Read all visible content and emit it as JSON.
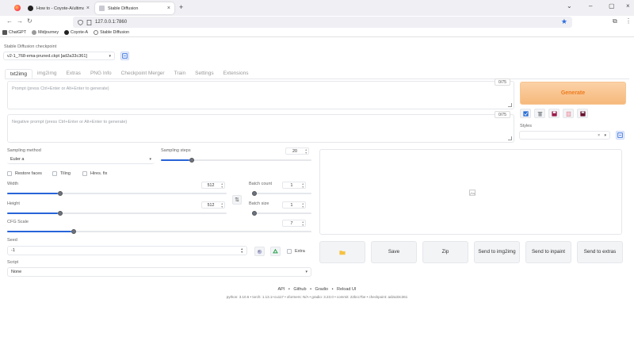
{
  "browser": {
    "tabs": [
      {
        "label": "How to - Coyote-A/ultimate-up",
        "active": false
      },
      {
        "label": "Stable Diffusion",
        "active": true
      }
    ],
    "url": "127.0.0.1:7860",
    "bookmarks": [
      "ChatGPT",
      "Midjourney",
      "Coyote-A",
      "Stable Diffusion"
    ]
  },
  "app": {
    "checkpoint": {
      "label": "Stable Diffusion checkpoint",
      "value": "v2-1_768-ema-pruned.ckpt [ad2a33c361]"
    },
    "tabs": [
      "txt2img",
      "img2img",
      "Extras",
      "PNG Info",
      "Checkpoint Merger",
      "Train",
      "Settings",
      "Extensions"
    ],
    "active_tab": "txt2img",
    "prompt": {
      "placeholder": "Prompt (press Ctrl+Enter or Alt+Enter to generate)",
      "counter": "0/75"
    },
    "negative_prompt": {
      "placeholder": "Negative prompt (press Ctrl+Enter or Alt+Enter to generate)",
      "counter": "0/75"
    },
    "generate_label": "Generate",
    "styles_label": "Styles",
    "sampling_method": {
      "label": "Sampling method",
      "value": "Euler a"
    },
    "sampling_steps": {
      "label": "Sampling steps",
      "value": "20",
      "fraction": 0.19
    },
    "checkboxes": [
      "Restore faces",
      "Tiling",
      "Hires. fix"
    ],
    "width": {
      "label": "Width",
      "value": "512",
      "fraction": 0.23
    },
    "height": {
      "label": "Height",
      "value": "512",
      "fraction": 0.23
    },
    "batch_count": {
      "label": "Batch count",
      "value": "1",
      "fraction": 0.0
    },
    "batch_size": {
      "label": "Batch size",
      "value": "1",
      "fraction": 0.0
    },
    "cfg_scale": {
      "label": "CFG Scale",
      "value": "7",
      "fraction": 0.21
    },
    "seed": {
      "label": "Seed",
      "value": "-1"
    },
    "extra_label": "Extra",
    "script": {
      "label": "Script",
      "value": "None"
    },
    "action_buttons": [
      "Save",
      "Zip",
      "Send to img2img",
      "Send to inpaint",
      "Send to extras"
    ],
    "footer_links": [
      "API",
      "Github",
      "Gradio",
      "Reload UI"
    ],
    "footer_info": "python: 3.10.6  •  torch: 1.13.1+cu117  •  xformers: N/A  •  gradio: 3.23.0  •  commit: 22bcc7be  •  checkpoint: ad2a33c361"
  },
  "colors": {
    "accent": "#2864d8",
    "generate": "#f6b97c",
    "generate_text": "#ee7b1d"
  }
}
